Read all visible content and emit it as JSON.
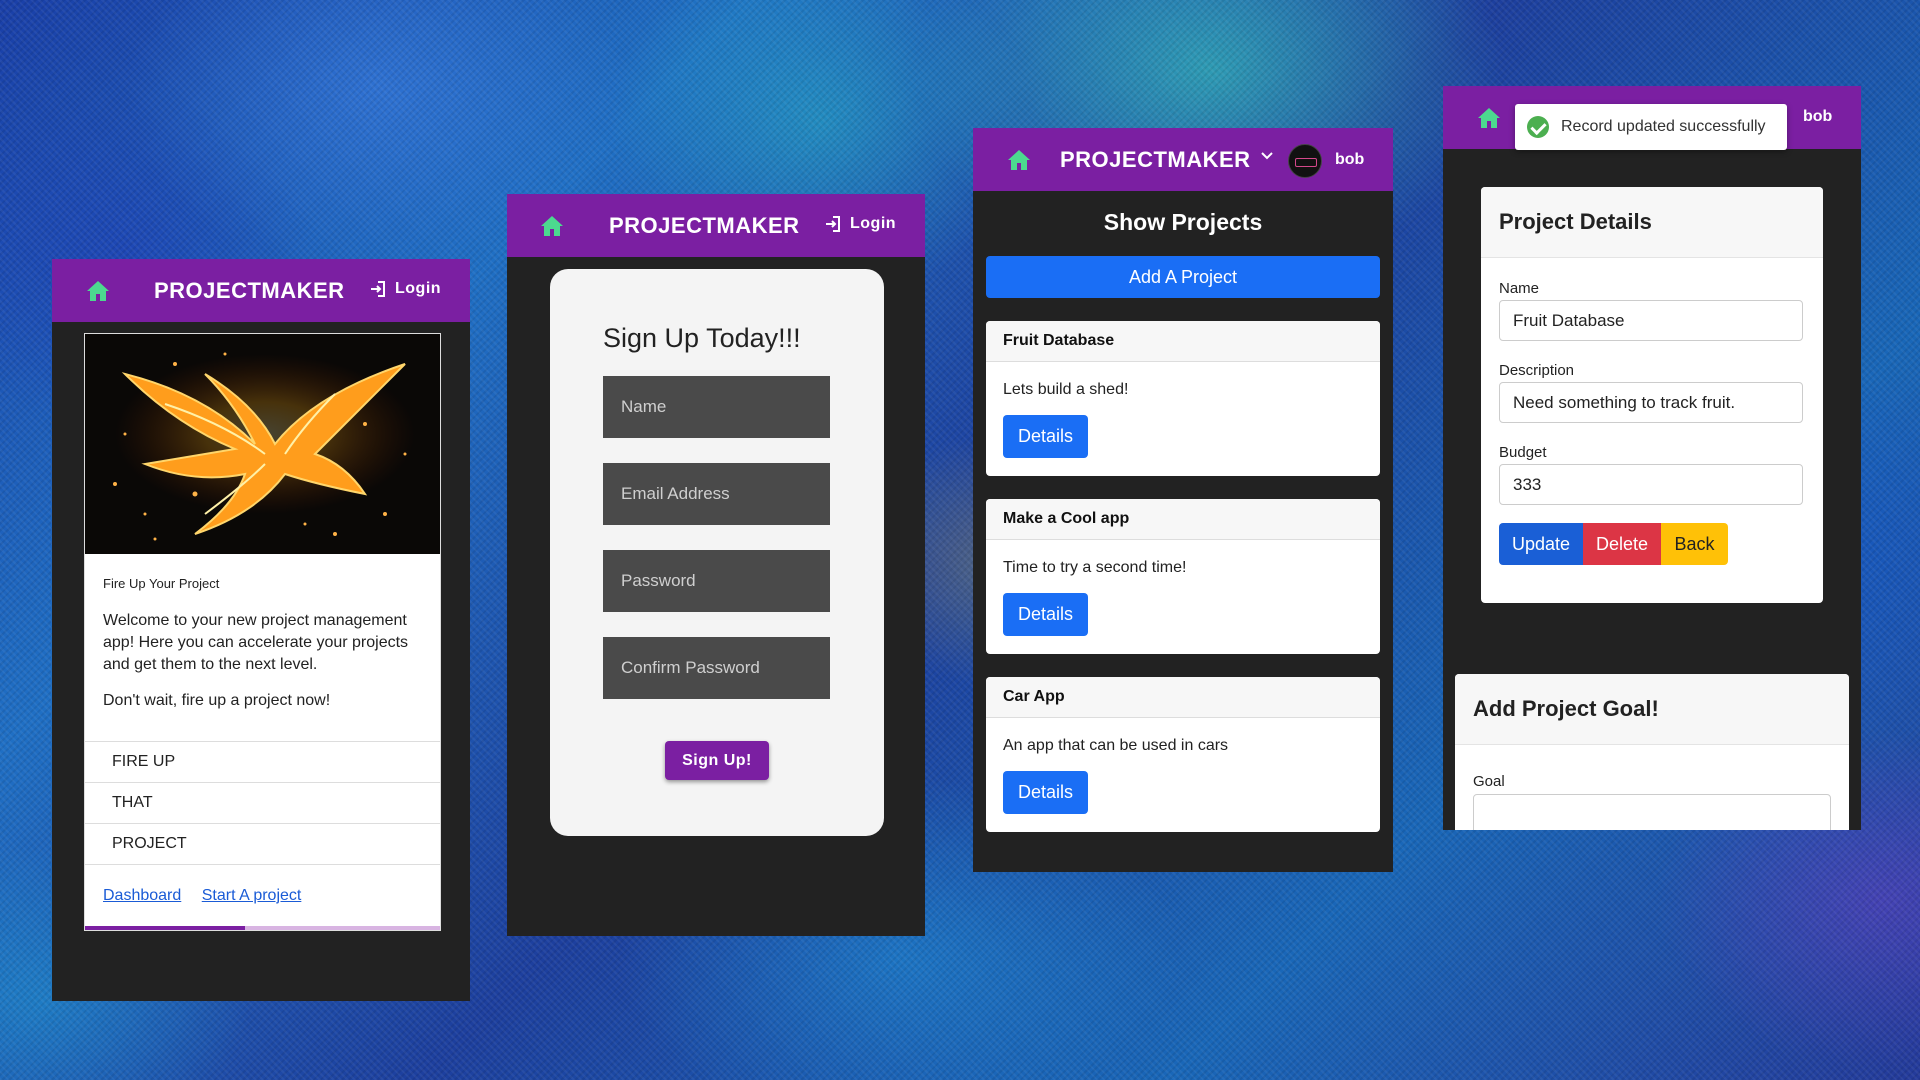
{
  "brand": "PROJECTMAKER",
  "login_label": "Login",
  "username": "bob",
  "home": {
    "card_subtitle": "Fire Up Your Project",
    "intro": "Welcome to your new project management app! Here you can accelerate your projects and get them to the next level.",
    "cta": "Don't wait, fire up a project now!",
    "list": [
      "FIRE UP",
      "THAT",
      "PROJECT"
    ],
    "links": [
      "Dashboard",
      "Start A project"
    ],
    "progress": 0.45
  },
  "signup": {
    "title": "Sign Up Today!!!",
    "fields": [
      "Name",
      "Email Address",
      "Password",
      "Confirm Password"
    ],
    "button": "Sign Up!"
  },
  "projects": {
    "title": "Show Projects",
    "add_button": "Add A Project",
    "details_label": "Details",
    "items": [
      {
        "name": "Fruit Database",
        "description": "Lets build a shed!"
      },
      {
        "name": "Make a Cool app",
        "description": "Time to try a second time!"
      },
      {
        "name": "Car App",
        "description": "An app that can be used in cars"
      }
    ]
  },
  "detail": {
    "toast": "Record updated successfully",
    "title": "Project Details",
    "name_label": "Name",
    "name_value": "Fruit Database",
    "description_label": "Description",
    "description_value": "Need something to track fruit.",
    "budget_label": "Budget",
    "budget_value": "333",
    "update": "Update",
    "delete": "Delete",
    "back": "Back",
    "goal_title": "Add Project Goal!",
    "goal_label": "Goal"
  },
  "colors": {
    "brand_purple": "#7b1fa2",
    "primary_blue": "#1a6ef5",
    "danger_red": "#dc3545",
    "warning_yellow": "#ffc107",
    "success_green": "#4caf50",
    "home_icon_green": "#4cd98f"
  }
}
